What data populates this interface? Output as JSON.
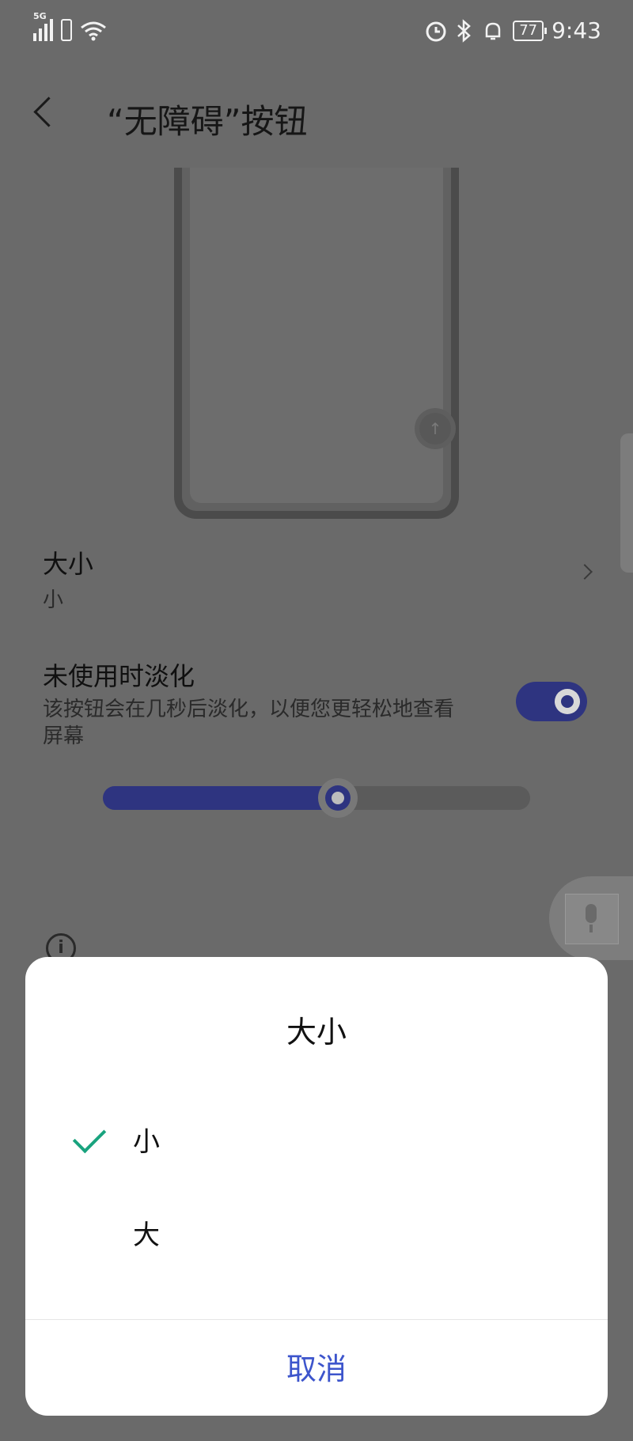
{
  "status_bar": {
    "network": "5G",
    "battery": "77",
    "time": "9:43",
    "icons": [
      "signal-icon",
      "sim-icon",
      "wifi-icon",
      "alarm-icon",
      "bluetooth-icon",
      "ring-icon",
      "battery-icon"
    ]
  },
  "header": {
    "title": "“无障碍”按钮"
  },
  "settings": {
    "size_title": "大小",
    "size_value": "小",
    "fade_title": "未使用时淡化",
    "fade_desc": "该按钮会在几秒后淡化，以便您更轻松地查看屏幕",
    "fade_enabled": true,
    "transparency_fraction": 0.55
  },
  "dialog": {
    "title": "大小",
    "options": [
      {
        "label": "小",
        "selected": true
      },
      {
        "label": "大",
        "selected": false
      }
    ],
    "cancel_label": "取消"
  },
  "colors": {
    "accent": "#2e3480",
    "check": "#19a37e",
    "cancel_text": "#3d55cc"
  }
}
